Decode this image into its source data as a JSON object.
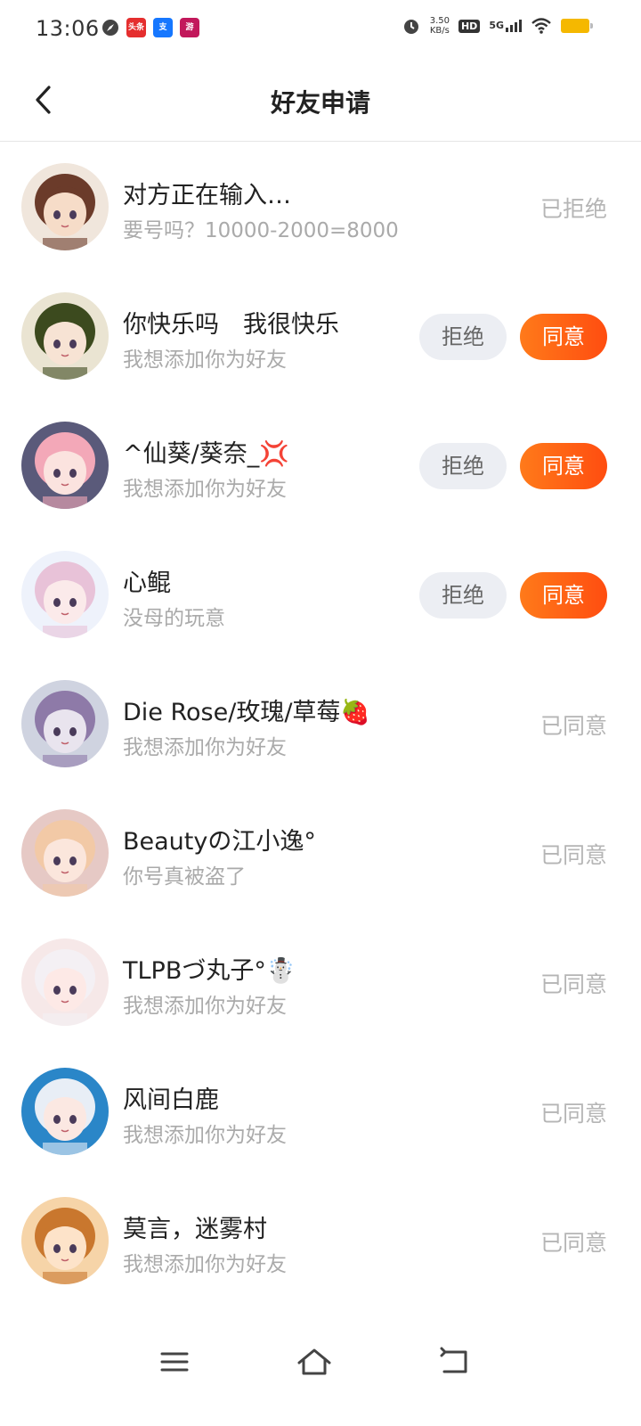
{
  "status_bar": {
    "time": "13:06",
    "net_speed_value": "3.50",
    "net_speed_unit": "KB/s",
    "hd": "HD",
    "network": "5G",
    "app_icons": [
      {
        "name": "toutiao",
        "label": "头条",
        "color": "#e52e2e"
      },
      {
        "name": "alipay",
        "label": "支",
        "color": "#1677ff"
      },
      {
        "name": "game",
        "label": "游",
        "color": "#c2185b"
      }
    ]
  },
  "header": {
    "title": "好友申请"
  },
  "requests": [
    {
      "name": "对方正在输入…",
      "message": "要号吗？10000-2000=8000",
      "status": "已拒绝",
      "pending": false,
      "avatar_bg": "#f0e6dc",
      "avatar_hair": "#6b3b2a",
      "avatar_skin": "#f6dcc8"
    },
    {
      "name": "你快乐吗　我很快乐",
      "message": "我想添加你为好友",
      "status": "",
      "pending": true,
      "avatar_bg": "#eae4d2",
      "avatar_hair": "#3c4a1e",
      "avatar_skin": "#f7e3d4"
    },
    {
      "name": "^仙葵/葵奈_💢",
      "message": "我想添加你为好友",
      "status": "",
      "pending": true,
      "avatar_bg": "#5a5a7a",
      "avatar_hair": "#f3a8b8",
      "avatar_skin": "#fbe3df"
    },
    {
      "name": "心鲲",
      "message": "没母的玩意",
      "status": "",
      "pending": true,
      "avatar_bg": "#eef2fb",
      "avatar_hair": "#e8c2d8",
      "avatar_skin": "#fbeaea"
    },
    {
      "name": "Die Rose/玫瑰/草莓🍓",
      "message": "我想添加你为好友",
      "status": "已同意",
      "pending": false,
      "avatar_bg": "#cfd3e0",
      "avatar_hair": "#8e7aa8",
      "avatar_skin": "#e9e4ee"
    },
    {
      "name": "Beautyの江小逸°",
      "message": "你号真被盗了",
      "status": "已同意",
      "pending": false,
      "avatar_bg": "#e6c9c5",
      "avatar_hair": "#f2c9a6",
      "avatar_skin": "#fbe6dc"
    },
    {
      "name": "TLPBづ丸子°☃️",
      "message": "我想添加你为好友",
      "status": "已同意",
      "pending": false,
      "avatar_bg": "#f6e8e8",
      "avatar_hair": "#f4f0f4",
      "avatar_skin": "#fde9e6"
    },
    {
      "name": "风间白鹿",
      "message": "我想添加你为好友",
      "status": "已同意",
      "pending": false,
      "avatar_bg": "#2a86c8",
      "avatar_hair": "#e8eef6",
      "avatar_skin": "#fbe8e2"
    },
    {
      "name": "莫言，迷雾村",
      "message": "我想添加你为好友",
      "status": "已同意",
      "pending": false,
      "avatar_bg": "#f6d4a8",
      "avatar_hair": "#c9772e",
      "avatar_skin": "#fde3c9"
    }
  ],
  "actions": {
    "reject_label": "拒绝",
    "accept_label": "同意"
  },
  "colors": {
    "accent": "#ff5a14",
    "muted": "#b5b5b5"
  }
}
